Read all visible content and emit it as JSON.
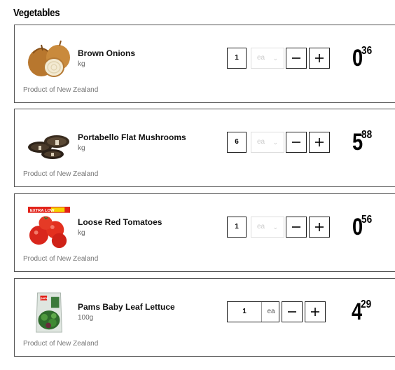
{
  "section_title": "Vegetables",
  "products": [
    {
      "name": "Brown Onions",
      "unit": "kg",
      "origin": "Product of New Zealand",
      "quantity": "1",
      "unit_select": "ea",
      "price_dollars": "0",
      "price_cents": "36",
      "image": "onion-image"
    },
    {
      "name": "Portabello Flat Mushrooms",
      "unit": "kg",
      "origin": "Product of New Zealand",
      "quantity": "6",
      "unit_select": "ea",
      "price_dollars": "5",
      "price_cents": "88",
      "image": "mushroom-image"
    },
    {
      "name": "Loose Red Tomatoes",
      "unit": "kg",
      "origin": "Product of New Zealand",
      "quantity": "1",
      "unit_select": "ea",
      "price_dollars": "0",
      "price_cents": "56",
      "image": "tomato-image",
      "badge": "EXTRA LOW"
    },
    {
      "name": "Pams Baby Leaf Lettuce",
      "unit": "100g",
      "origin": "Product of New Zealand",
      "quantity": "1",
      "unit_select": "ea",
      "price_dollars": "4",
      "price_cents": "29",
      "image": "lettuce-bag-image",
      "bag_label": "pams"
    }
  ],
  "icons": {
    "decrease": "minus-icon",
    "increase": "plus-icon",
    "dropdown": "chevron-down-icon"
  }
}
